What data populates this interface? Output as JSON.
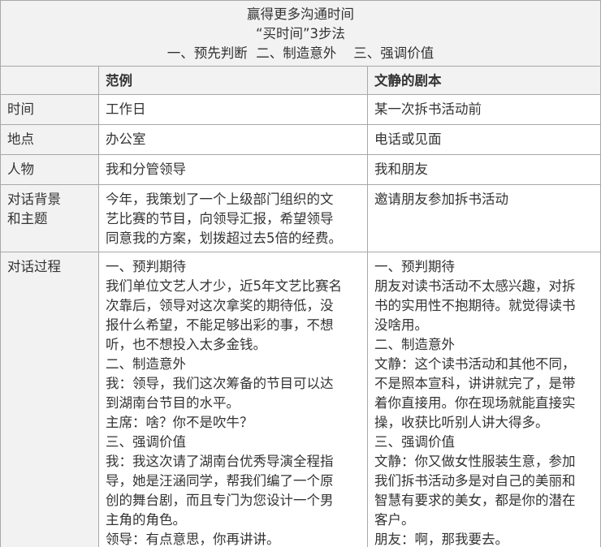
{
  "title": {
    "line1": "赢得更多沟通时间",
    "line2": "“买时间”3步法",
    "line3": "一、预先判断  二、制造意外    三、强调价值"
  },
  "header": {
    "col1": "",
    "col2": "范例",
    "col3": "文静的剧本"
  },
  "rows": [
    {
      "label": [
        "时间"
      ],
      "example": [
        "工作日"
      ],
      "script": [
        "某一次拆书活动前"
      ]
    },
    {
      "label": [
        "地点"
      ],
      "example": [
        "办公室"
      ],
      "script": [
        "电话或见面"
      ]
    },
    {
      "label": [
        "人物"
      ],
      "example": [
        "我和分管领导"
      ],
      "script": [
        "我和朋友"
      ]
    },
    {
      "label": [
        "对话背景",
        "和主题"
      ],
      "example": [
        "今年，我策划了一个上级部门组织的文",
        "艺比赛的节目，向领导汇报，希望领导",
        "同意我的方案，划拨超过去5倍的经费。"
      ],
      "script": [
        "邀请朋友参加拆书活动"
      ]
    },
    {
      "label": [
        "对话过程"
      ],
      "example": [
        "一、预判期待",
        "我们单位文艺人才少，近5年文艺比赛名",
        "次靠后，领导对这次拿奖的期待低，没",
        "报什么希望，不能足够出彩的事，不想",
        "听，也不想投入太多金钱。",
        "二、制造意外",
        "我：领导，我们这次筹备的节目可以达",
        "到湖南台节目的水平。",
        "主席：啥？你不是吹牛？",
        "三、强调价值",
        "我：我这次请了湖南台优秀导演全程指",
        "导，她是汪涵同学，帮我们编了一个原",
        "创的舞台剧，而且专门为您设计一个男",
        "主角的角色。",
        "领导：有点意思，你再讲讲。"
      ],
      "script": [
        "一、预判期待",
        "朋友对读书活动不太感兴趣，对拆",
        "书的实用性不抱期待。就觉得读书",
        "没啥用。",
        "二、制造意外",
        "文静：这个读书活动和其他不同，",
        "不是照本宣科，讲讲就完了，是带",
        "着你直接用。你在现场就能直接实",
        "操，收获比听别人讲大得多。",
        "三、强调价值",
        "文静：你又做女性服装生意，参加",
        "我们拆书活动多是对自己的美丽和",
        "智慧有要求的美女，都是你的潜在",
        "客户。",
        "朋友：啊，那我要去。"
      ]
    }
  ]
}
